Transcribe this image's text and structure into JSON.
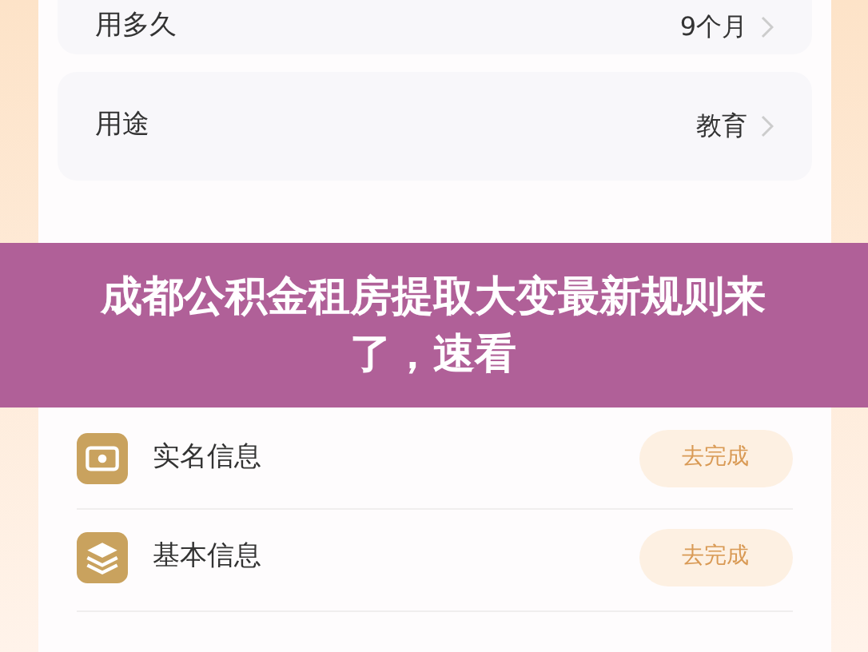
{
  "form_rows": [
    {
      "label": "用多久",
      "value": "9个月"
    },
    {
      "label": "用途",
      "value": "教育"
    }
  ],
  "banner": {
    "title": "成都公积金租房提取大变最新规则来了，速看"
  },
  "tasks": [
    {
      "kind": "id",
      "label": "实名信息",
      "action": "去完成"
    },
    {
      "kind": "layers",
      "label": "基本信息",
      "action": "去完成"
    }
  ]
}
